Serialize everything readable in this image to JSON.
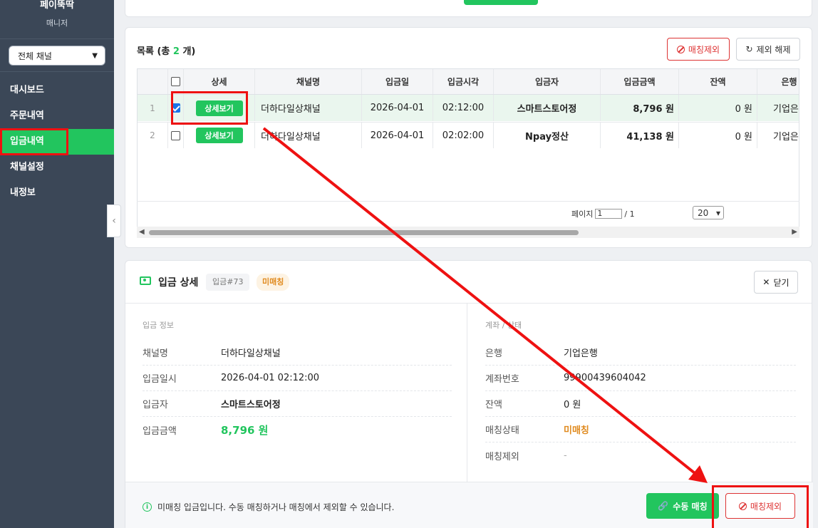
{
  "sidebar": {
    "brand": "페이뚝딱",
    "role": "매니저",
    "channel_select": "전체 채널",
    "menu": [
      {
        "label": "대시보드"
      },
      {
        "label": "주문내역"
      },
      {
        "label": "입금내역"
      },
      {
        "label": "채널설정"
      },
      {
        "label": "내정보"
      }
    ]
  },
  "list": {
    "title_prefix": "목록 (총 ",
    "count": "2",
    "title_suffix": " 개)",
    "exclude_btn": "매칭제외",
    "unexclude_btn": "제외 해제",
    "columns": [
      "상세",
      "채널명",
      "입금일",
      "입금시각",
      "입금자",
      "입금금액",
      "잔액",
      "은행"
    ],
    "detail_btn": "상세보기",
    "rows": [
      {
        "no": "1",
        "checked": true,
        "channel": "더하다일상채널",
        "date": "2026-04-01",
        "time": "02:12:00",
        "payer": "스마트스토어정",
        "amount": "8,796 원",
        "balance": "0 원",
        "bank": "기업은행"
      },
      {
        "no": "2",
        "checked": false,
        "channel": "더하다일상채널",
        "date": "2026-04-01",
        "time": "02:02:00",
        "payer": "Npay정산",
        "amount": "41,138 원",
        "balance": "0 원",
        "bank": "기업은행"
      }
    ],
    "pager_label": "페이지",
    "page": "1",
    "page_total": "/ 1",
    "page_size": "20"
  },
  "detail": {
    "title": "입금 상세",
    "tag": "입금#73",
    "badge": "미매칭",
    "close_btn": "닫기",
    "left_title": "입금 정보",
    "left": [
      {
        "k": "채널명",
        "v": "더하다일상채널"
      },
      {
        "k": "입금일시",
        "v": "2026-04-01 02:12:00"
      },
      {
        "k": "입금자",
        "v": "스마트스토어정"
      },
      {
        "k": "입금금액",
        "v": "8,796 원"
      }
    ],
    "right_title": "계좌 / 상태",
    "right": [
      {
        "k": "은행",
        "v": "기업은행"
      },
      {
        "k": "계좌번호",
        "v": "99900439604042"
      },
      {
        "k": "잔액",
        "v": "0 원"
      },
      {
        "k": "매칭상태",
        "v": "미매칭"
      },
      {
        "k": "매칭제외",
        "v": "-"
      }
    ],
    "footer_info": "미매칭 입금입니다. 수동 매칭하거나 매칭에서 제외할 수 있습니다.",
    "manual_btn": "수동 매칭",
    "exclude_btn": "매칭제외"
  },
  "colors": {
    "accent": "#22c55e",
    "sidebar": "#3b4757",
    "danger": "#dd3333",
    "warning": "#e08a1e",
    "annotation": "#ee1111"
  }
}
